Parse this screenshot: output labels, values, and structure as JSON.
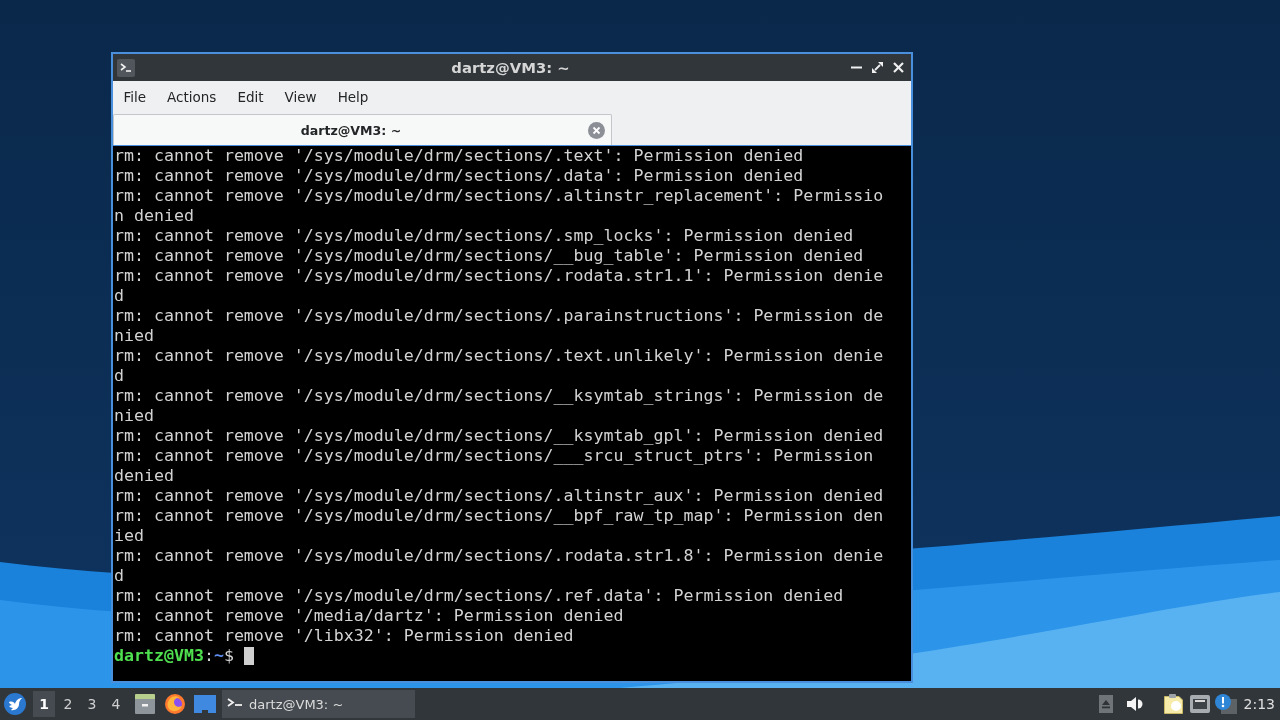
{
  "window": {
    "title": "dartz@VM3: ~",
    "menu": [
      "File",
      "Actions",
      "Edit",
      "View",
      "Help"
    ],
    "tabs": [
      {
        "label": "dartz@VM3: ~",
        "selected": true
      }
    ]
  },
  "terminal": {
    "lines": [
      "rm: cannot remove '/sys/module/drm/sections/.text': Permission denied",
      "rm: cannot remove '/sys/module/drm/sections/.data': Permission denied",
      "rm: cannot remove '/sys/module/drm/sections/.altinstr_replacement': Permission denied",
      "rm: cannot remove '/sys/module/drm/sections/.smp_locks': Permission denied",
      "rm: cannot remove '/sys/module/drm/sections/__bug_table': Permission denied",
      "rm: cannot remove '/sys/module/drm/sections/.rodata.str1.1': Permission denied",
      "rm: cannot remove '/sys/module/drm/sections/.parainstructions': Permission denied",
      "rm: cannot remove '/sys/module/drm/sections/.text.unlikely': Permission denied",
      "rm: cannot remove '/sys/module/drm/sections/__ksymtab_strings': Permission denied",
      "rm: cannot remove '/sys/module/drm/sections/__ksymtab_gpl': Permission denied",
      "rm: cannot remove '/sys/module/drm/sections/___srcu_struct_ptrs': Permission denied",
      "rm: cannot remove '/sys/module/drm/sections/.altinstr_aux': Permission denied",
      "rm: cannot remove '/sys/module/drm/sections/__bpf_raw_tp_map': Permission denied",
      "rm: cannot remove '/sys/module/drm/sections/.rodata.str1.8': Permission denied",
      "rm: cannot remove '/sys/module/drm/sections/.ref.data': Permission denied",
      "rm: cannot remove '/media/dartz': Permission denied",
      "rm: cannot remove '/libx32': Permission denied"
    ],
    "prompt": {
      "user_host": "dartz@VM3",
      "separator": ":",
      "path": "~",
      "symbol": "$"
    }
  },
  "taskbar": {
    "workspaces": [
      {
        "label": "1",
        "selected": true
      },
      {
        "label": "2",
        "selected": false
      },
      {
        "label": "3",
        "selected": false
      },
      {
        "label": "4",
        "selected": false
      }
    ],
    "tasks": [
      {
        "label": "dartz@VM3: ~",
        "selected": true
      }
    ],
    "clock": "2:13"
  }
}
